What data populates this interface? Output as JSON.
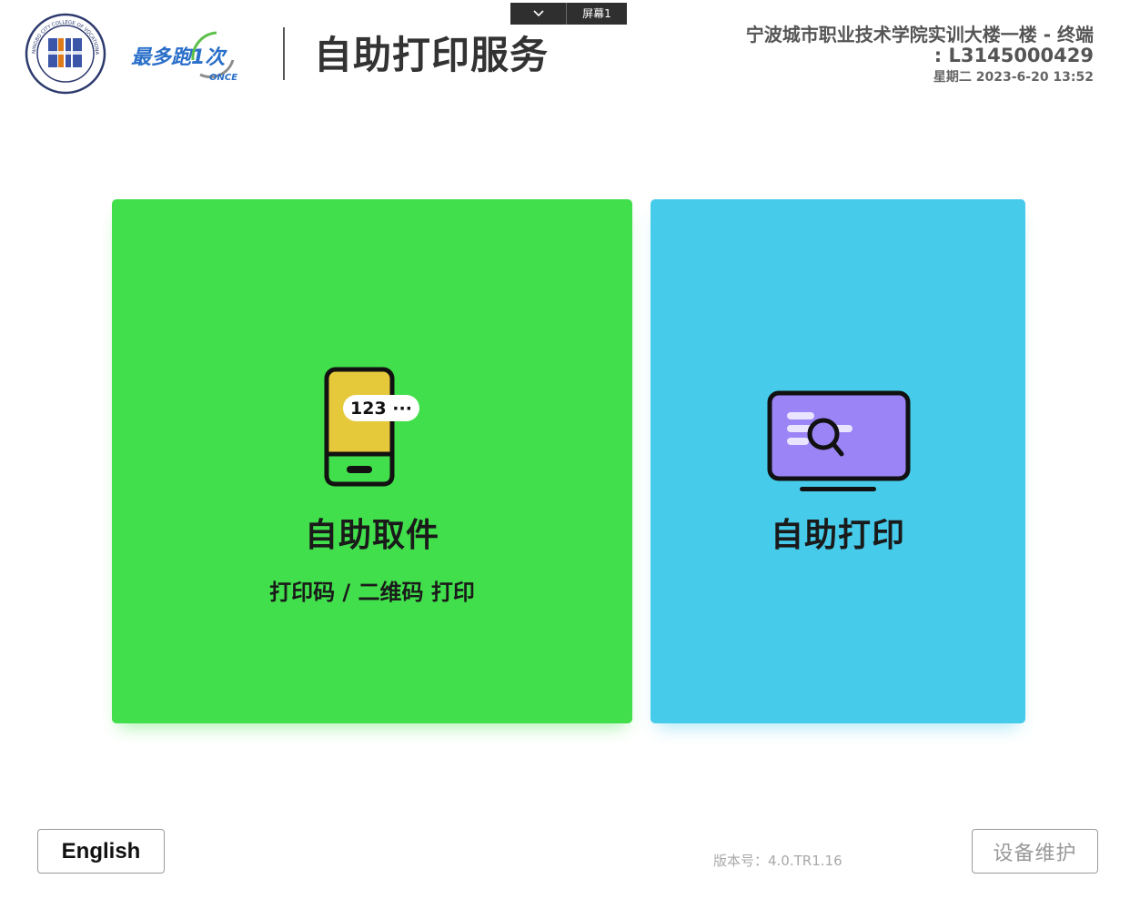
{
  "header": {
    "title": "自助打印服务",
    "screen_switcher": {
      "label": "屏幕1",
      "icon": "chevron-down-icon"
    },
    "terminal": {
      "name": "宁波城市职业技术学院实训大楼一楼 - 终端",
      "id": ": L3145000429",
      "datetime": "星期二 2023-6-20 13:52"
    },
    "logos": {
      "seal_text": "NINGBO CITY COLLEGE OF VOCATIONAL TECHNOLOGY",
      "brand_text": "最多跑1次",
      "brand_sub": "ONCE"
    }
  },
  "cards": {
    "pickup": {
      "title": "自助取件",
      "subtitle": "打印码 / 二维码 打印",
      "phone_badge": "123 ···",
      "color": "#41df4b",
      "icon": "phone-code-icon"
    },
    "print": {
      "title": "自助打印",
      "color": "#46cbea",
      "icon": "monitor-search-icon"
    }
  },
  "footer": {
    "english_label": "English",
    "version": "版本号：4.0.TR1.16",
    "maintenance_label": "设备维护"
  }
}
